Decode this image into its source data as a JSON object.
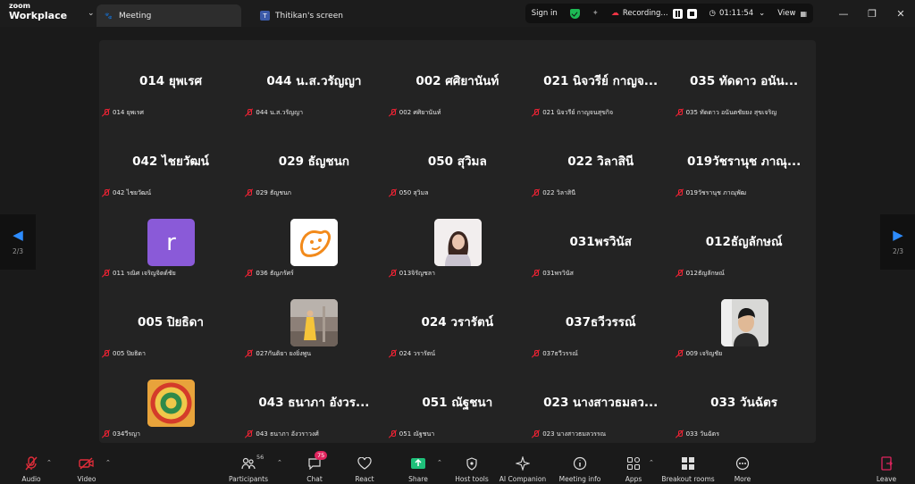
{
  "app": {
    "brand_line1": "zoom",
    "brand_line2": "Workplace"
  },
  "tabs": [
    {
      "label": "Meeting",
      "active": true
    },
    {
      "label": "Thitikan's screen",
      "active": false
    }
  ],
  "header": {
    "sign_in": "Sign in",
    "recording_label": "Recording...",
    "timer": "01:11:54",
    "view_label": "View"
  },
  "pagination": {
    "left": "2/3",
    "right": "2/3"
  },
  "tiles": [
    {
      "display": "014 ยุพเรศ",
      "label": "014 ยุพเรศ"
    },
    {
      "display": "044 น.ส.วรัญญา",
      "label": "044 น.ส.วรัญญา"
    },
    {
      "display": "002 ศศิยานันท์",
      "label": "002 ศศิยานันท์"
    },
    {
      "display": "021 นิจวรีย์ กาญจ...",
      "label": "021 นิจวรีย์ กาญจนสุขกิจ"
    },
    {
      "display": "035 ทัดดาว อนัน...",
      "label": "035 ทัดดาว อนันตชัยยง สุขเจริญ"
    },
    {
      "display": "042 ไชยวัฒน์",
      "label": "042 ไชยวัฒน์"
    },
    {
      "display": "029 ธัญชนก",
      "label": "029 ธัญชนก"
    },
    {
      "display": "050 สุวิมล",
      "label": "050 สุวิมล"
    },
    {
      "display": "022 วิลาสินี",
      "label": "022 วิลาสินี"
    },
    {
      "display": "019วัชรานุช ภาณุ...",
      "label": "019วัชรานุช ภาณุพัฒ"
    },
    {
      "avatar": "letter",
      "avatar_text": "r",
      "avatar_color": "#8a5ad8",
      "label": "011 รณิศ เจริญจิตต์ชัย"
    },
    {
      "avatar": "logo",
      "avatar_color": "#ffffff",
      "label": "036 ธัญภรัศร์"
    },
    {
      "avatar": "photo-woman",
      "avatar_color": "#d6cfcf",
      "label": "013จิรัญชลา"
    },
    {
      "display": "031พรวินัส",
      "label": "031พรวินัส"
    },
    {
      "display": "012ธัญลักษณ์",
      "label": "012ธัญลักษณ์"
    },
    {
      "display": "005 ปิยธิดา",
      "label": "005 ปิยธิดา"
    },
    {
      "avatar": "photo-yellow",
      "avatar_color": "#9c8f86",
      "label": "027กันติยา ยงยิ่งพูน"
    },
    {
      "display": "024 วรารัตน์",
      "label": "024 วรารัตน์"
    },
    {
      "display": "037ธวีวรรณ์",
      "label": "037ธวีวรรณ์"
    },
    {
      "avatar": "photo-man",
      "avatar_color": "#cfcfcf",
      "label": "009 เจริญชัย"
    },
    {
      "avatar": "emblem",
      "avatar_color": "#e8a33b",
      "label": "034วีรญา"
    },
    {
      "display": "043 ธนาภา อังวร...",
      "label": "043 ธนาภา อังวราวงศ์"
    },
    {
      "display": "051 ณัฐชนา",
      "label": "051 ณัฐชนา"
    },
    {
      "display": "023 นางสาวธมลว...",
      "label": "023 นางสาวธมลวรรณ"
    },
    {
      "display": "033 วันฉัตร",
      "label": "033 วันฉัตร"
    }
  ],
  "toolbar": {
    "audio": "Audio",
    "video": "Video",
    "participants": "Participants",
    "participants_count": "56",
    "chat": "Chat",
    "chat_badge": "75",
    "react": "React",
    "share": "Share",
    "host_tools": "Host tools",
    "ai_companion": "AI Companion",
    "meeting_info": "Meeting info",
    "apps": "Apps",
    "breakout_rooms": "Breakout rooms",
    "more": "More",
    "leave": "Leave"
  },
  "colors": {
    "accent": "#2d8cff",
    "share_green": "#1ec07a",
    "leave_red": "#e0245e",
    "muted_red": "#e22d3a"
  }
}
